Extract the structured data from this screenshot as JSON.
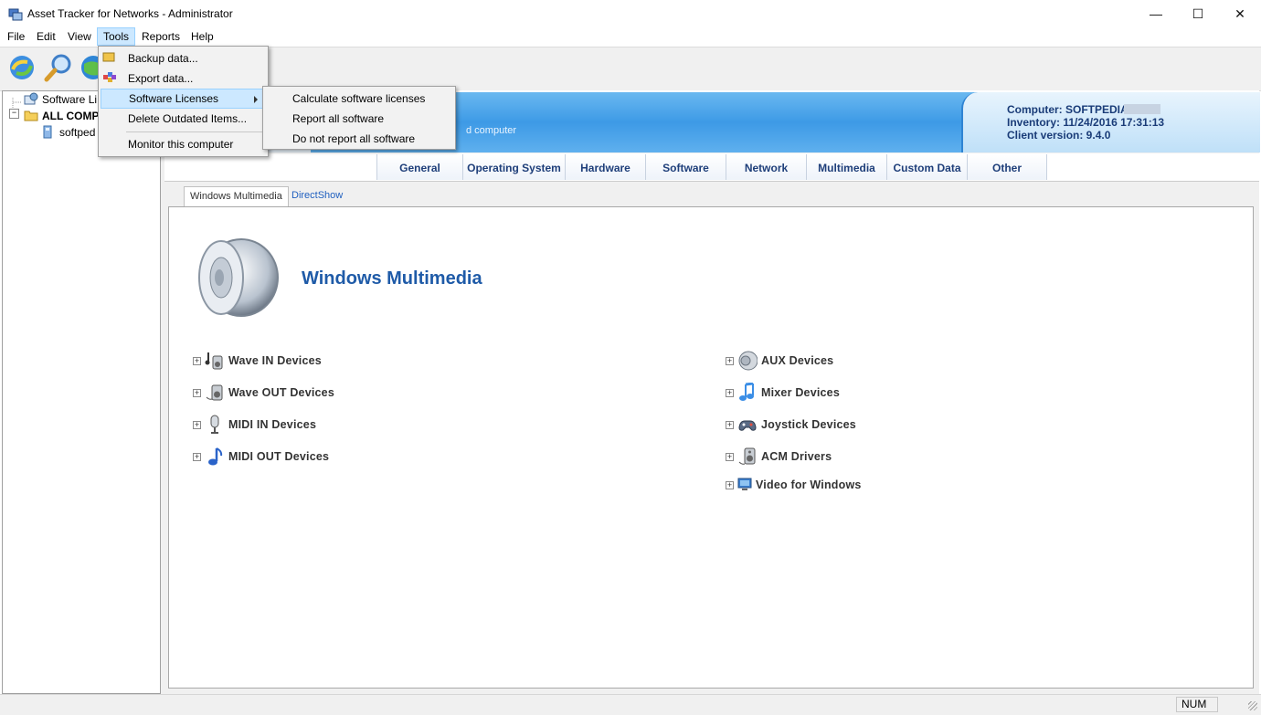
{
  "window": {
    "title": "Asset Tracker for Networks - Administrator",
    "minimize": "—",
    "maximize": "☐",
    "close": "✕"
  },
  "menubar": {
    "items": [
      "File",
      "Edit",
      "View",
      "Tools",
      "Reports",
      "Help"
    ],
    "open_menu": "Tools"
  },
  "tools_menu": {
    "items": [
      {
        "label": "Backup data...",
        "icon": "backup-icon"
      },
      {
        "label": "Export data...",
        "icon": "export-icon"
      },
      {
        "label": "Software Licenses",
        "icon": "",
        "submenu": true
      },
      {
        "label": "Delete Outdated Items...",
        "icon": ""
      },
      {
        "label": "Monitor this computer",
        "icon": ""
      }
    ]
  },
  "licenses_submenu": {
    "items": [
      "Calculate software licenses",
      "Report all software",
      "Do not report all software"
    ]
  },
  "tree": {
    "items": [
      {
        "label": "Software Li",
        "icon": "software-icon"
      },
      {
        "label": "ALL COMPU",
        "icon": "folder-icon"
      },
      {
        "label": "softped",
        "icon": "computer-icon"
      }
    ]
  },
  "banner": {
    "partial_text": "d computer",
    "computer_label": "Computer: SOFTPEDIA",
    "inventory_label": "Inventory: 11/24/2016 17:31:13",
    "client_label": "Client version: 9.4.0"
  },
  "tabs": [
    "General",
    "Operating System",
    "Hardware",
    "Software",
    "Network",
    "Multimedia",
    "Custom Data",
    "Other"
  ],
  "subtabs": [
    "Windows Multimedia",
    "DirectShow"
  ],
  "section": {
    "title": "Windows Multimedia"
  },
  "devices_left": [
    {
      "label": "Wave IN Devices",
      "icon": "wave-in-icon"
    },
    {
      "label": "Wave OUT Devices",
      "icon": "wave-out-icon"
    },
    {
      "label": "MIDI IN Devices",
      "icon": "microphone-icon"
    },
    {
      "label": "MIDI OUT Devices",
      "icon": "music-note-icon"
    }
  ],
  "devices_right": [
    {
      "label": "AUX Devices",
      "icon": "aux-speaker-icon"
    },
    {
      "label": "Mixer Devices",
      "icon": "mixer-note-icon"
    },
    {
      "label": "Joystick Devices",
      "icon": "joystick-icon"
    },
    {
      "label": "ACM Drivers",
      "icon": "acm-speaker-icon"
    },
    {
      "label": "Video for Windows",
      "icon": "monitor-icon"
    }
  ],
  "statusbar": {
    "num": "NUM"
  },
  "colors": {
    "accent": "#1f5ba8",
    "banner_blue": "#3d9ae6",
    "menu_highlight": "#cce8ff"
  }
}
